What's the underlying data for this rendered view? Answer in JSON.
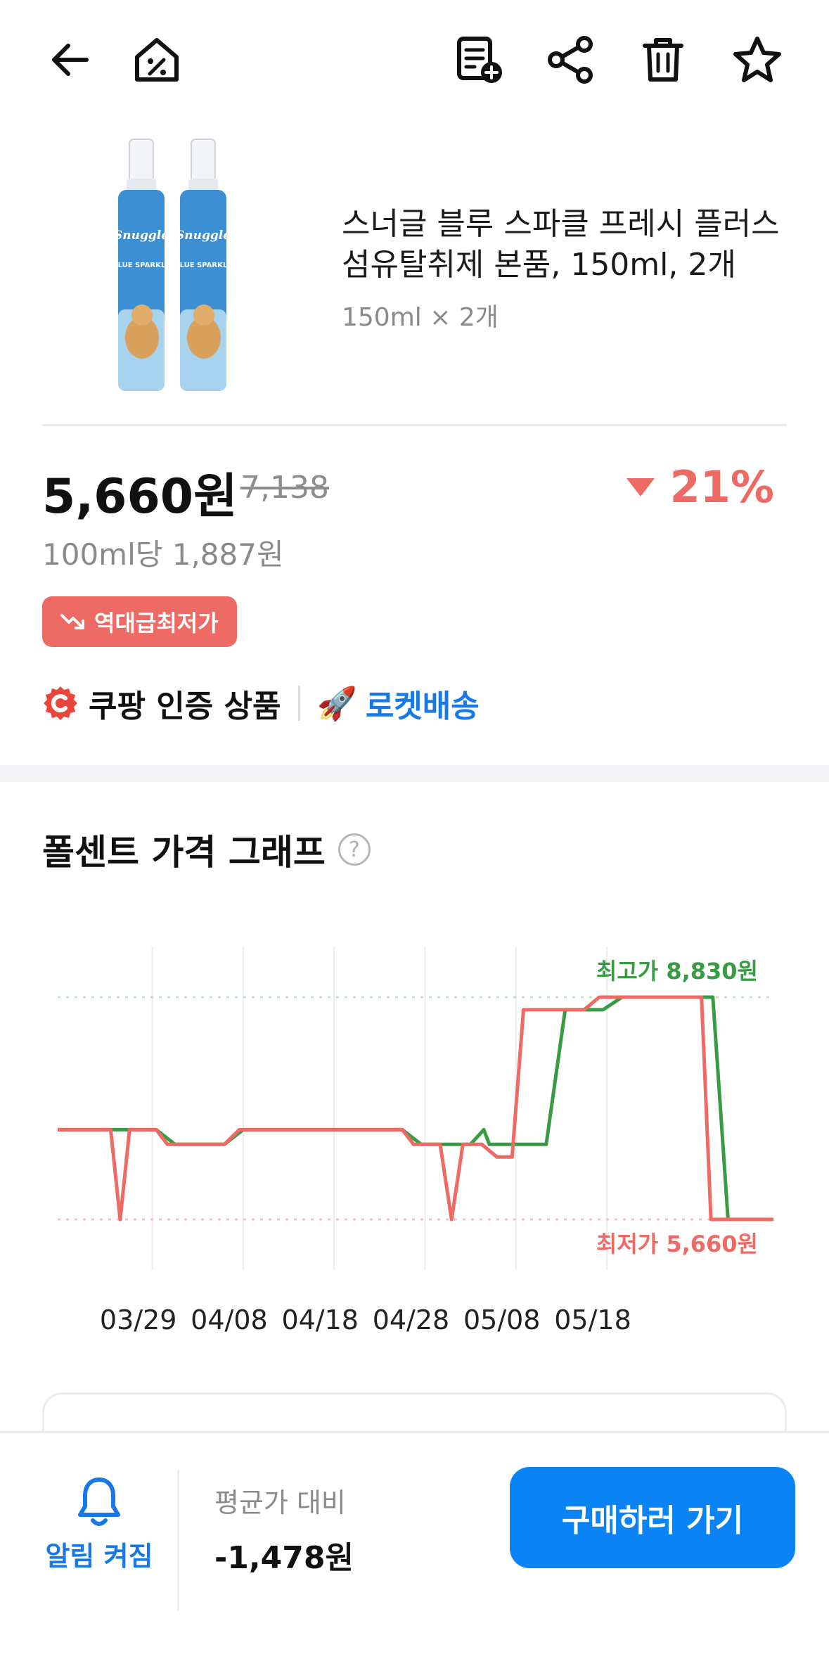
{
  "colors": {
    "accent_blue": "#1778e6",
    "button_blue": "#0a84f5",
    "discount_red": "#ee6a64",
    "series_green": "#3a9b45",
    "series_red": "#ee6a64"
  },
  "header": {
    "icons": [
      "back-arrow-icon",
      "discount-home-icon",
      "add-to-list-icon",
      "share-icon",
      "trash-icon",
      "star-icon"
    ]
  },
  "product": {
    "title": "스너글 블루 스파클 프레시 플러스 섬유탈취제 본품, 150ml, 2개",
    "subtitle": "150ml × 2개",
    "image_brand": "Snuggle",
    "image_line": "BLUE SPARKLE"
  },
  "price": {
    "current": "5,660원",
    "original": "7,138",
    "discount": "21%",
    "unit_price": "100ml당 1,887원",
    "badge": "역대급최저가"
  },
  "certification": {
    "coupang": "쿠팡 인증 상품",
    "rocket": "로켓배송"
  },
  "graph": {
    "title": "폴센트 가격 그래프",
    "help": "?"
  },
  "chart_data": {
    "type": "line",
    "x_tick_labels": [
      "03/29",
      "04/08",
      "04/18",
      "04/28",
      "05/08",
      "05/18"
    ],
    "high_label": "최고가 8,830원",
    "low_label": "최저가 5,660원",
    "high_value": 8830,
    "low_value": 5660,
    "ylim": [
      5660,
      8830
    ],
    "grid": "vertical",
    "series": [
      {
        "color": "#3a9b45",
        "points": [
          [
            0,
            6940
          ],
          [
            5.2,
            6940
          ],
          [
            6.2,
            6730
          ],
          [
            8.8,
            6730
          ],
          [
            9.8,
            6940
          ],
          [
            18.2,
            6940
          ],
          [
            19.2,
            6730
          ],
          [
            21.8,
            6730
          ],
          [
            22.5,
            6940
          ],
          [
            22.8,
            6730
          ],
          [
            25.8,
            6730
          ],
          [
            26.8,
            8650
          ],
          [
            28.8,
            8650
          ],
          [
            29.8,
            8830
          ],
          [
            34.6,
            8830
          ],
          [
            35.4,
            5660
          ],
          [
            37.8,
            5660
          ]
        ]
      },
      {
        "color": "#ee6a64",
        "points": [
          [
            0,
            6940
          ],
          [
            2.8,
            6940
          ],
          [
            3.3,
            5660
          ],
          [
            3.8,
            6940
          ],
          [
            5.2,
            6940
          ],
          [
            5.8,
            6730
          ],
          [
            8.8,
            6730
          ],
          [
            9.6,
            6940
          ],
          [
            18.2,
            6940
          ],
          [
            18.8,
            6730
          ],
          [
            20.2,
            6730
          ],
          [
            20.8,
            5660
          ],
          [
            21.4,
            6730
          ],
          [
            22.4,
            6730
          ],
          [
            23.2,
            6550
          ],
          [
            24.0,
            6550
          ],
          [
            24.6,
            8650
          ],
          [
            27.8,
            8650
          ],
          [
            28.6,
            8830
          ],
          [
            34.0,
            8830
          ],
          [
            34.5,
            5660
          ],
          [
            37.8,
            5660
          ]
        ]
      }
    ]
  },
  "bottom": {
    "alarm_label": "알림 켜짐",
    "compare_label": "평균가 대비",
    "compare_value": "-1,478원",
    "buy_button": "구매하러 가기"
  }
}
